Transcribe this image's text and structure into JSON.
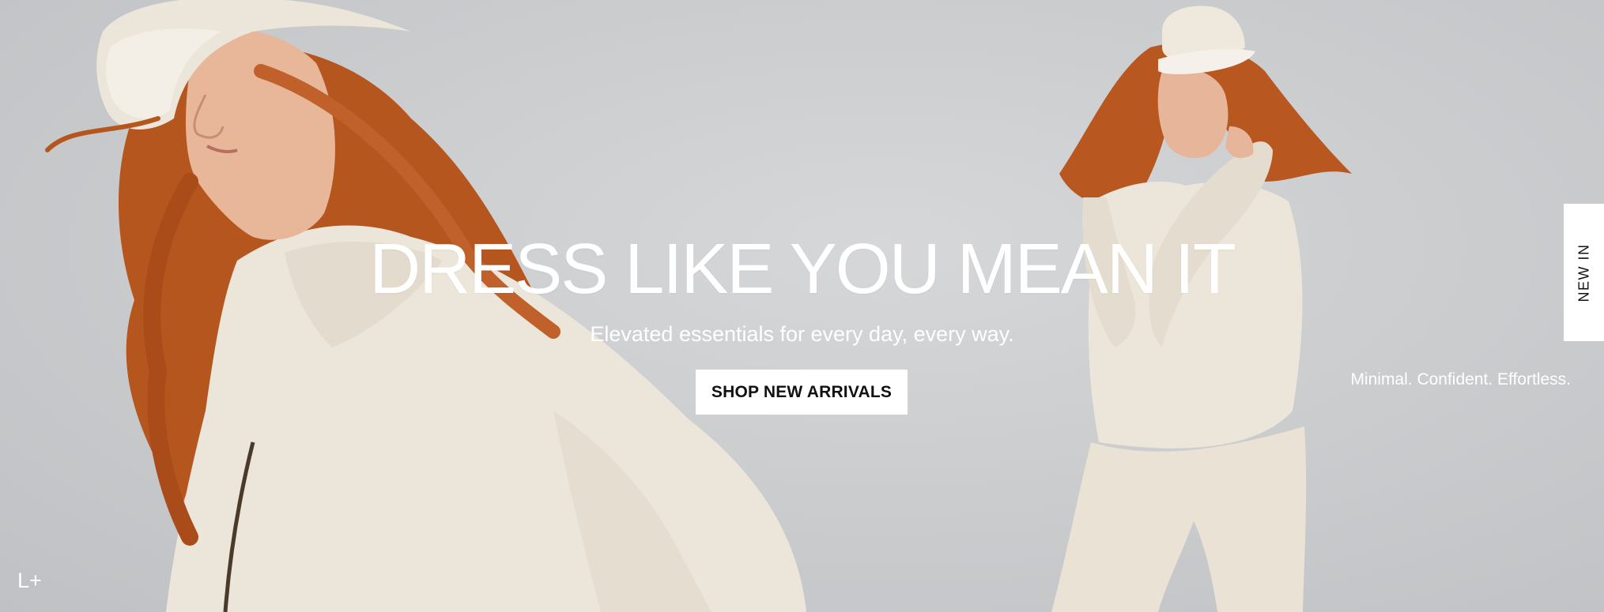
{
  "hero": {
    "headline": "DRESS LIKE YOU MEAN IT",
    "subheadline": "Elevated essentials for every day, every way.",
    "cta_label": "SHOP NEW ARRIVALS",
    "tagline": "Minimal. Confident. Effortless."
  },
  "side_tab": {
    "label": "NEW IN"
  },
  "brand": {
    "logo_text": "L+"
  },
  "colors": {
    "background": "#c9cbcd",
    "text": "#ffffff",
    "button_bg": "#ffffff",
    "button_text": "#111111",
    "garment": "#ede7dc",
    "hair": "#b5531f"
  }
}
